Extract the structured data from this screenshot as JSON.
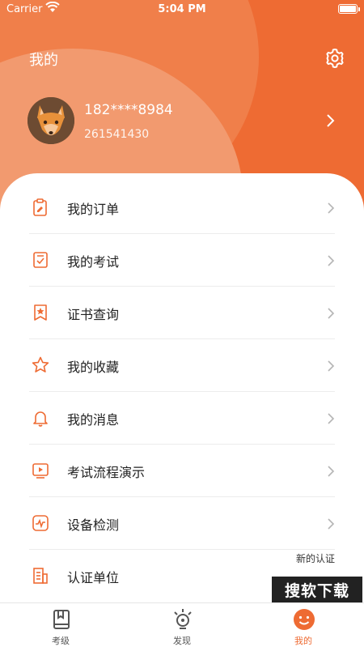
{
  "status_bar": {
    "carrier": "Carrier",
    "time": "5:04 PM"
  },
  "header": {
    "title": "我的"
  },
  "profile": {
    "phone": "182****8984",
    "user_id": "261541430"
  },
  "menu": [
    {
      "label": "我的订单",
      "icon": "clipboard-icon"
    },
    {
      "label": "我的考试",
      "icon": "checked-doc-icon"
    },
    {
      "label": "证书查询",
      "icon": "certificate-icon"
    },
    {
      "label": "我的收藏",
      "icon": "star-icon"
    },
    {
      "label": "我的消息",
      "icon": "bell-icon"
    },
    {
      "label": "考试流程演示",
      "icon": "video-icon"
    },
    {
      "label": "设备检测",
      "icon": "monitor-icon"
    },
    {
      "label": "认证单位",
      "icon": "building-icon",
      "extra": "新的认证"
    }
  ],
  "tabs": [
    {
      "label": "考级",
      "icon": "book-icon"
    },
    {
      "label": "发现",
      "icon": "bulb-icon"
    },
    {
      "label": "我的",
      "icon": "smile-icon",
      "active": true
    }
  ],
  "watermark": "搜软下载",
  "colors": {
    "accent": "#ee6b33",
    "accent_light": "#f29a6f",
    "text": "#222222"
  }
}
